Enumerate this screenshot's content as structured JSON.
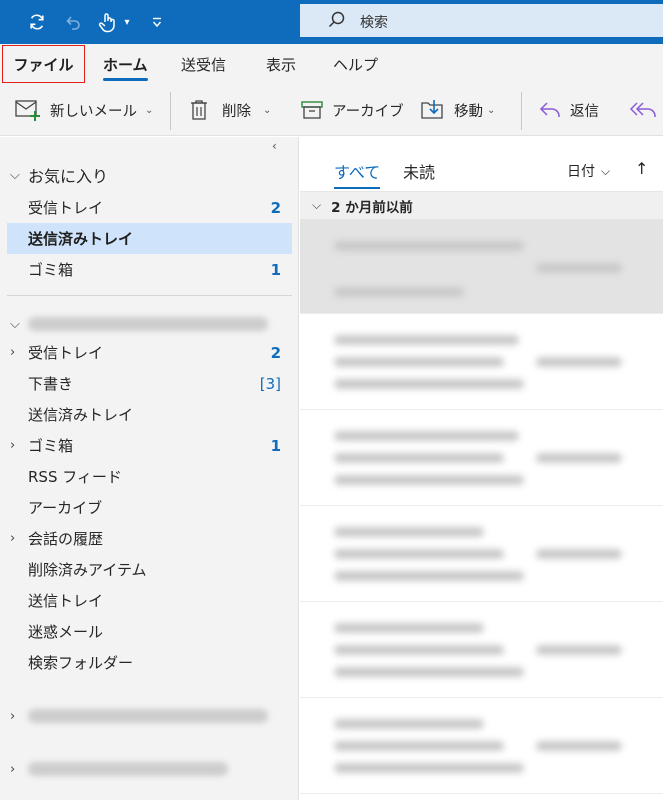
{
  "search": {
    "placeholder": "検索"
  },
  "menu": {
    "tabs": [
      "ファイル",
      "ホーム",
      "送受信",
      "表示",
      "ヘルプ"
    ]
  },
  "ribbon": {
    "new_mail": "新しいメール",
    "delete": "削除",
    "archive": "アーカイブ",
    "move": "移動",
    "reply": "返信"
  },
  "sidebar": {
    "favorites_title": "お気に入り",
    "favorites": [
      {
        "name": "受信トレイ",
        "count": "2"
      },
      {
        "name": "送信済みトレイ",
        "count": ""
      },
      {
        "name": "ゴミ箱",
        "count": "1"
      }
    ],
    "account_folders": [
      {
        "name": "受信トレイ",
        "count": "2",
        "expandable": true
      },
      {
        "name": "下書き",
        "count": "[3]",
        "expandable": false
      },
      {
        "name": "送信済みトレイ",
        "count": "",
        "expandable": false
      },
      {
        "name": "ゴミ箱",
        "count": "1",
        "expandable": true
      },
      {
        "name": "RSS フィード",
        "count": "",
        "expandable": false
      },
      {
        "name": "アーカイブ",
        "count": "",
        "expandable": false
      },
      {
        "name": "会話の履歴",
        "count": "",
        "expandable": true
      },
      {
        "name": "削除済みアイテム",
        "count": "",
        "expandable": false
      },
      {
        "name": "送信トレイ",
        "count": "",
        "expandable": false
      },
      {
        "name": "迷惑メール",
        "count": "",
        "expandable": false
      },
      {
        "name": "検索フォルダー",
        "count": "",
        "expandable": false
      }
    ]
  },
  "message_list": {
    "tab_all": "すべて",
    "tab_unread": "未読",
    "sort_label": "日付",
    "group_header": "2 か月前以前"
  },
  "colors": {
    "accent": "#0f6cbd",
    "file_highlight": "#e0201a",
    "selected_folder": "#cfe4fa",
    "reply_all_icon": "#8a5bd6"
  }
}
